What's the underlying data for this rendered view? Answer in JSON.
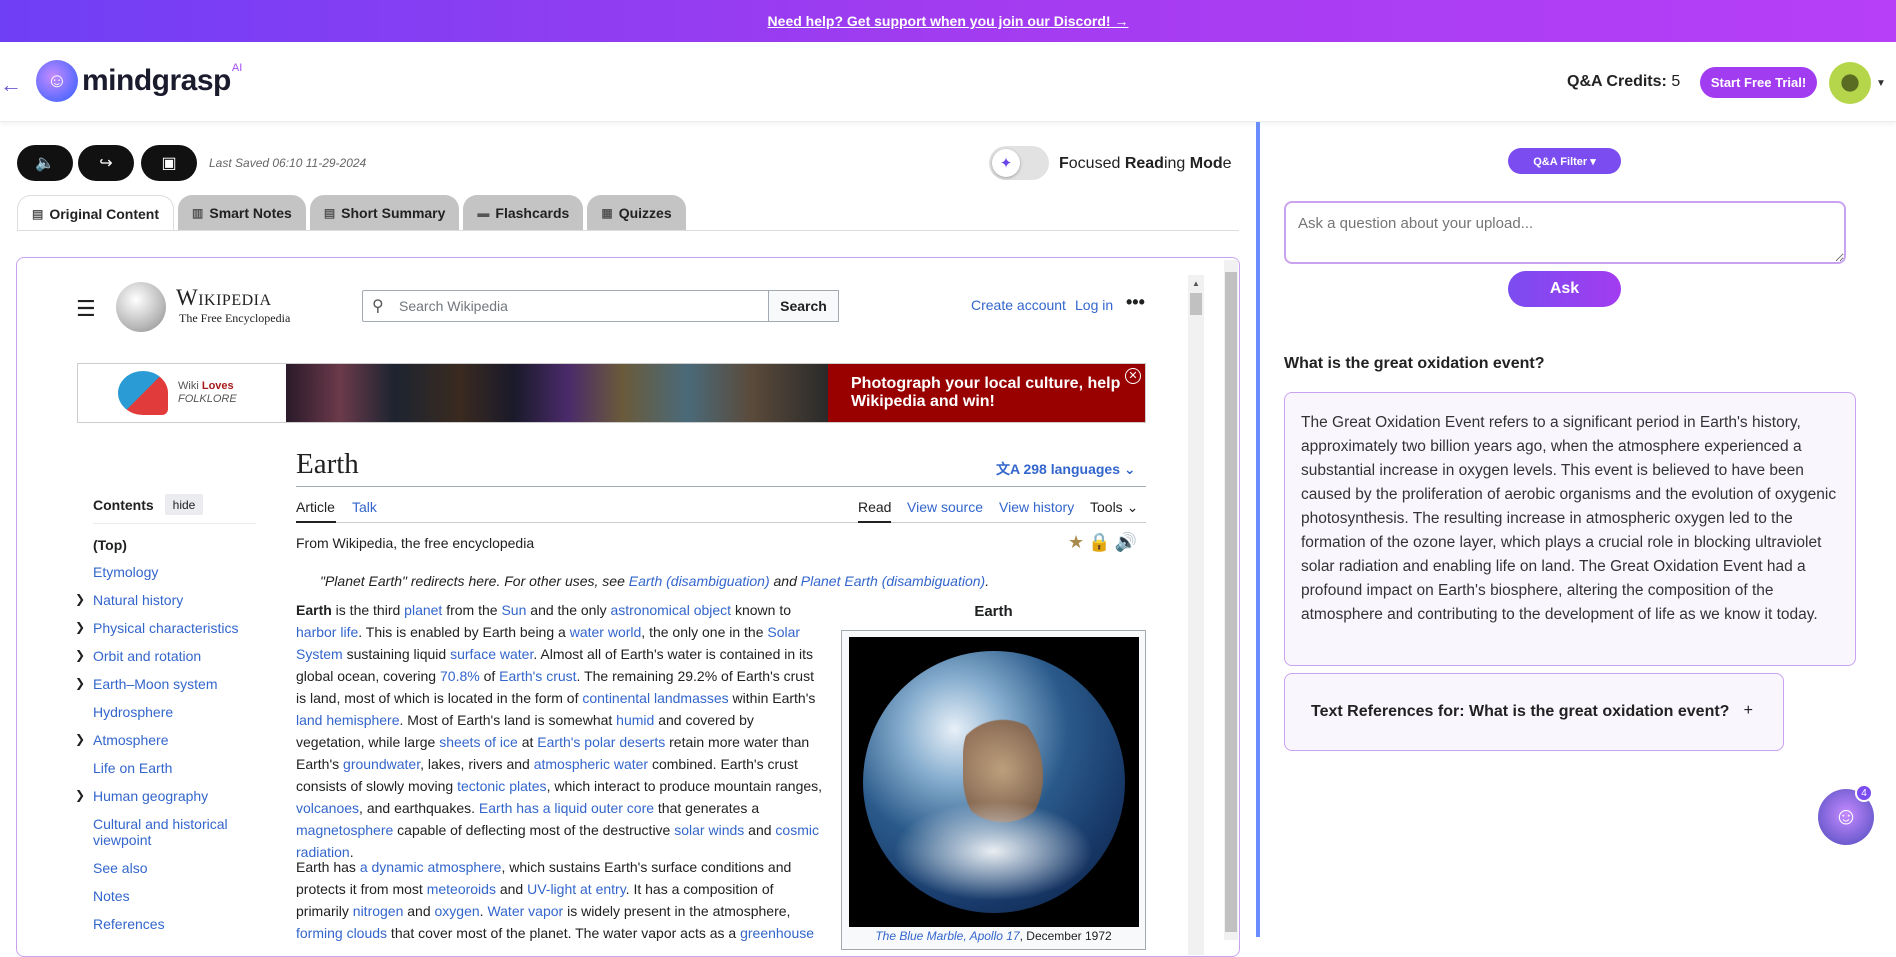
{
  "banner": {
    "text": "Need help? Get support when you join our Discord! →"
  },
  "header": {
    "logo_text": "mindgrasp",
    "logo_ai": "AI",
    "credits_label": "Q&A Credits:",
    "credits_value": "5",
    "trial_label": "Start Free Trial!"
  },
  "toolbar": {
    "last_saved": "Last Saved 06:10 11-29-2024",
    "focused_mode": {
      "F": "F",
      "o": "ocused ",
      "R": "Read",
      "ing": "ing ",
      "M": "Mod",
      "e": "e"
    }
  },
  "tabs": [
    {
      "label": "Original Content"
    },
    {
      "label": "Smart Notes"
    },
    {
      "label": "Short Summary"
    },
    {
      "label": "Flashcards"
    },
    {
      "label": "Quizzes"
    }
  ],
  "wiki": {
    "title": "Wikipedia",
    "subtitle": "The Free Encyclopedia",
    "search_placeholder": "Search Wikipedia",
    "search_btn": "Search",
    "create_account": "Create account",
    "log_in": "Log in",
    "banner_wiki": "Wiki",
    "banner_loves": "Loves",
    "banner_folklore": "FOLKLORE",
    "banner_cta": "Photograph your local culture, help Wikipedia and win!",
    "page_title": "Earth",
    "languages": "298 languages",
    "tab_article": "Article",
    "tab_talk": "Talk",
    "tab_read": "Read",
    "tab_view_source": "View source",
    "tab_view_history": "View history",
    "tab_tools": "Tools",
    "from": "From Wikipedia, the free encyclopedia",
    "hatnote_pre": "\"Planet Earth\" redirects here. For other uses, see ",
    "hatnote_link1": "Earth (disambiguation)",
    "hatnote_mid": " and ",
    "hatnote_link2": "Planet Earth (disambiguation)",
    "hatnote_end": ".",
    "contents_title": "Contents",
    "hide": "hide",
    "toc": [
      {
        "label": "(Top)"
      },
      {
        "label": "Etymology"
      },
      {
        "label": "Natural history"
      },
      {
        "label": "Physical characteristics"
      },
      {
        "label": "Orbit and rotation"
      },
      {
        "label": "Earth–Moon system"
      },
      {
        "label": "Hydrosphere"
      },
      {
        "label": "Atmosphere"
      },
      {
        "label": "Life on Earth"
      },
      {
        "label": "Human geography"
      },
      {
        "label": "Cultural and historical viewpoint"
      },
      {
        "label": "See also"
      },
      {
        "label": "Notes"
      },
      {
        "label": "References"
      }
    ],
    "infobox_title": "Earth",
    "infobox_caption_link": "The Blue Marble, Apollo 17",
    "infobox_caption_rest": ", December 1972"
  },
  "qa": {
    "filter_label": "Q&A Filter ▾",
    "input_placeholder": "Ask a question about your upload...",
    "ask_label": "Ask",
    "question": "What is the great oxidation event?",
    "answer": "The Great Oxidation Event refers to a significant period in Earth's history, approximately two billion years ago, when the atmosphere experienced a substantial increase in oxygen levels. This event is believed to have been caused by the proliferation of aerobic organisms and the evolution of oxygenic photosynthesis. The resulting increase in atmospheric oxygen led to the formation of the ozone layer, which plays a crucial role in blocking ultraviolet solar radiation and enabling life on land. The Great Oxidation Event had a profound impact on Earth's biosphere, altering the composition of the atmosphere and contributing to the development of life as we know it today.",
    "refs_label": "Text References for: What is the great oxidation event?",
    "refs_plus": "+",
    "chat_badge": "4"
  }
}
